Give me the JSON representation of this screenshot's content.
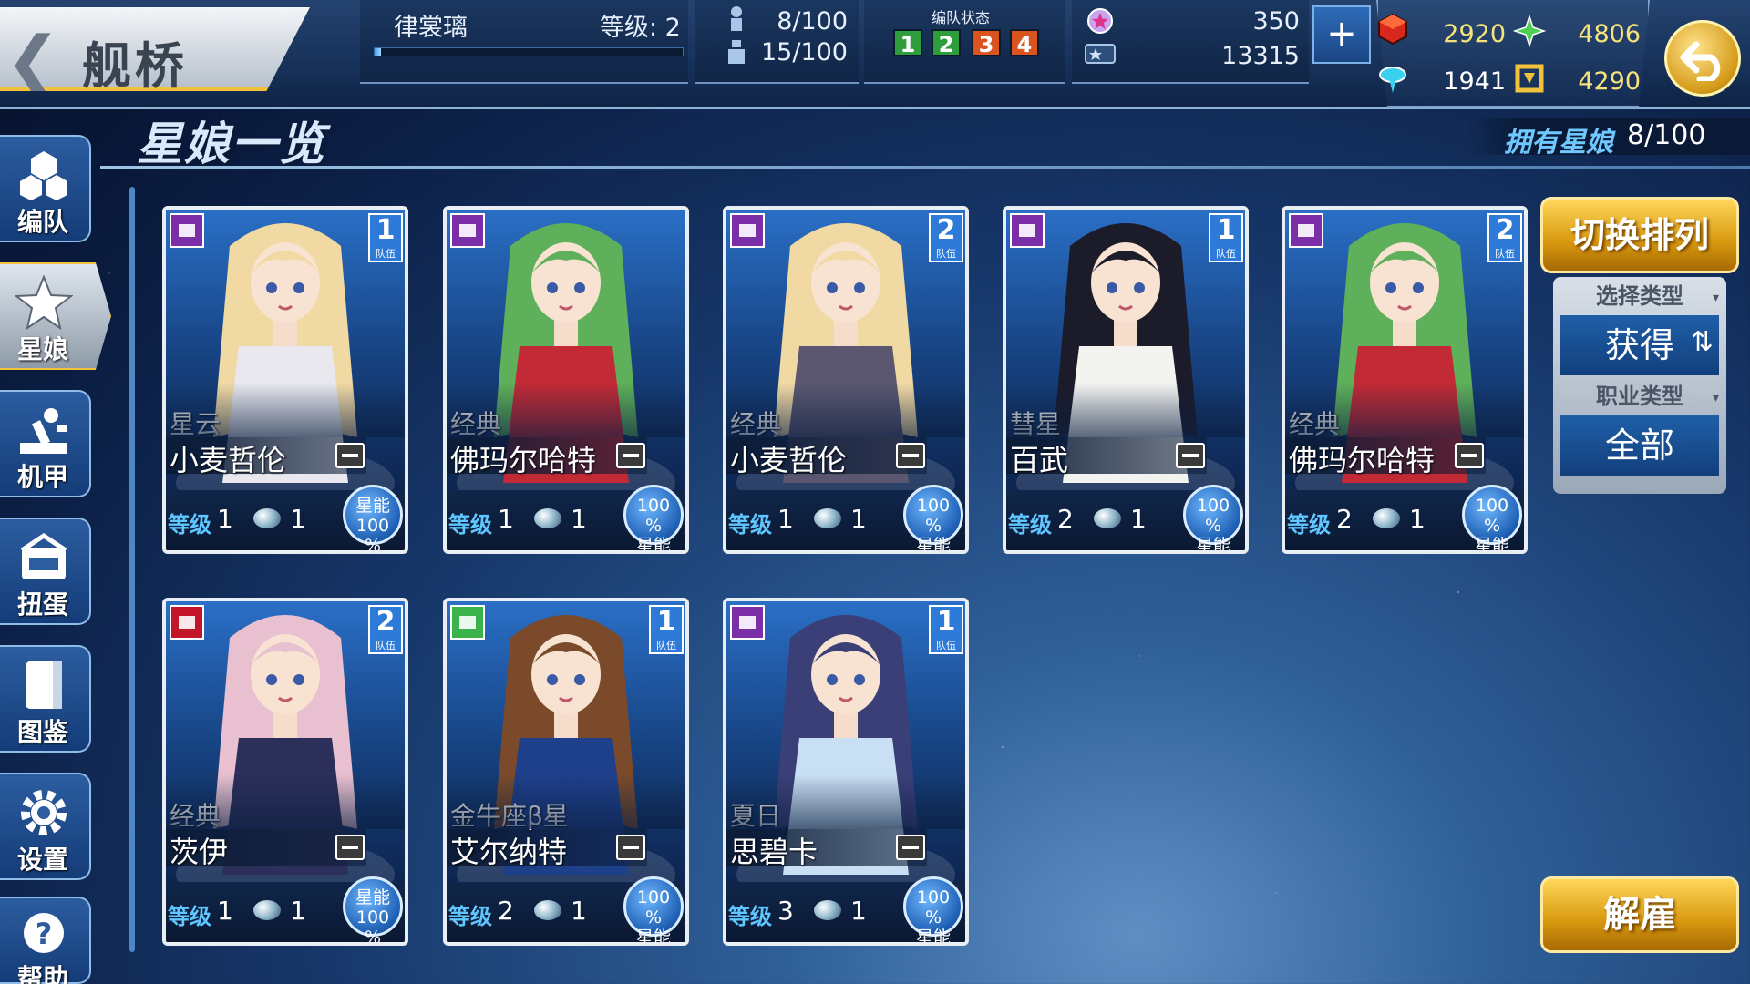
{
  "header": {
    "title": "舰桥",
    "player_name": "律裳璃",
    "level_label": "等级: 2",
    "xp_fraction": 0.02,
    "crew_count": "8/100",
    "mecha_count": "15/100",
    "formation_status_label": "编队状态",
    "formation_slots": [
      "1",
      "2",
      "3",
      "4"
    ],
    "star_points": "350",
    "star_coins": "13315",
    "plus_label": "+",
    "resources": {
      "cube": "2920",
      "green_star": "4806",
      "pin": "1941",
      "gold_frame": "4290"
    }
  },
  "subtitle": "星娘一览",
  "owned": {
    "label": "拥有星娘",
    "value": "8/100"
  },
  "sidebar": {
    "items": [
      {
        "label": "编队",
        "icon": "formation-icon"
      },
      {
        "label": "星娘",
        "icon": "star-girl-icon"
      },
      {
        "label": "机甲",
        "icon": "mecha-icon"
      },
      {
        "label": "扭蛋",
        "icon": "gacha-icon"
      },
      {
        "label": "图鉴",
        "icon": "codex-icon"
      },
      {
        "label": "设置",
        "icon": "gear-icon"
      },
      {
        "label": "帮助",
        "icon": "help-icon"
      }
    ]
  },
  "labels": {
    "level": "等级",
    "team": "队伍",
    "energy_top": "星能",
    "energy_pct": "100 %"
  },
  "cards": [
    {
      "series": "星云",
      "name": "小麦哲伦",
      "level": "1",
      "cores": "1",
      "team": "1",
      "type": "purple",
      "energy_order": "label-first",
      "hair": "#f1d9a4",
      "outfit": "#e8e8ee"
    },
    {
      "series": "经典",
      "name": "佛玛尔哈特",
      "level": "1",
      "cores": "1",
      "team": "",
      "type": "purple",
      "energy_order": "pct-first",
      "hair": "#5fb05a",
      "outfit": "#c22a36"
    },
    {
      "series": "经典",
      "name": "小麦哲伦",
      "level": "1",
      "cores": "1",
      "team": "2",
      "type": "purple",
      "energy_order": "pct-first",
      "hair": "#f1d9a4",
      "outfit": "#5b5770"
    },
    {
      "series": "彗星",
      "name": "百武",
      "level": "2",
      "cores": "1",
      "team": "1",
      "type": "purple",
      "energy_order": "pct-first",
      "hair": "#1b1b2a",
      "outfit": "#f3f3f0"
    },
    {
      "series": "经典",
      "name": "佛玛尔哈特",
      "level": "2",
      "cores": "1",
      "team": "2",
      "type": "purple",
      "energy_order": "pct-first",
      "hair": "#5fb05a",
      "outfit": "#c22a36"
    },
    {
      "series": "经典",
      "name": "茨伊",
      "level": "1",
      "cores": "1",
      "team": "2",
      "type": "red",
      "energy_order": "label-first",
      "hair": "#e8c0cf",
      "outfit": "#2b2f5a"
    },
    {
      "series": "金牛座β星",
      "name": "艾尔纳特",
      "level": "2",
      "cores": "1",
      "team": "1",
      "type": "green",
      "energy_order": "pct-first",
      "hair": "#7a4a2a",
      "outfit": "#1e3f8a"
    },
    {
      "series": "夏日",
      "name": "思碧卡",
      "level": "3",
      "cores": "1",
      "team": "1",
      "type": "purple",
      "energy_order": "pct-first",
      "hair": "#3a3f78",
      "outfit": "#c9dff3"
    }
  ],
  "right_panel": {
    "sort_button": "切换排列",
    "select_type_label": "选择类型",
    "select_type_value": "获得",
    "job_type_label": "职业类型",
    "job_type_value": "全部",
    "dismiss_button": "解雇"
  },
  "colors": {
    "accent_gold": "#f2c23a",
    "resource_text": "#f6e27a",
    "level_label": "#5fc6ff",
    "formation": [
      "#2e9d3c",
      "#2e9d3c",
      "#d9541e",
      "#d9541e"
    ]
  }
}
